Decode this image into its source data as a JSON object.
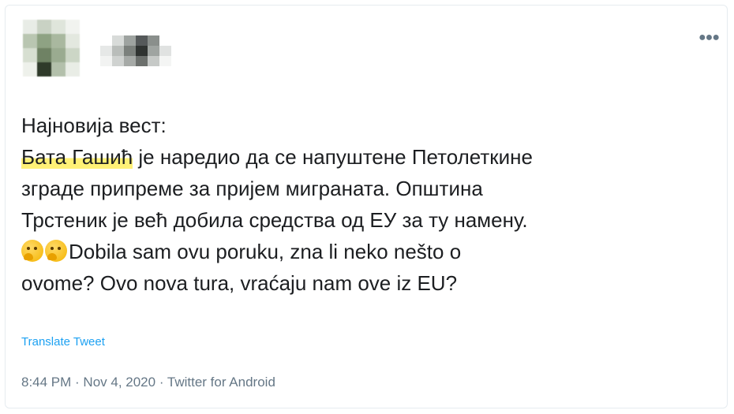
{
  "tweet": {
    "text_lines": {
      "l1": "Најновија вест:",
      "l2_highlight": "Бата Гашић",
      "l2_rest": " је наредио да се напуштене Петолеткине",
      "l3": "зграде припреме за пријем миграната. Општина",
      "l4": "Трстеник је већ добила средства од ЕУ за ту намену.",
      "l5": "Dobila sam ovu poruku, zna li neko nešto o",
      "l6": "ovome? Ovo nova tura, vraćaju nam ove iz EU?"
    },
    "emoji_icons": [
      "thinking-face",
      "thinking-face"
    ],
    "translate_label": "Translate Tweet",
    "timestamp": "8:44 PM · Nov 4, 2020 · Twitter for Android",
    "more_icon": "more-options-icon",
    "highlight_color": "#fff176",
    "link_color": "#1da1f2"
  }
}
